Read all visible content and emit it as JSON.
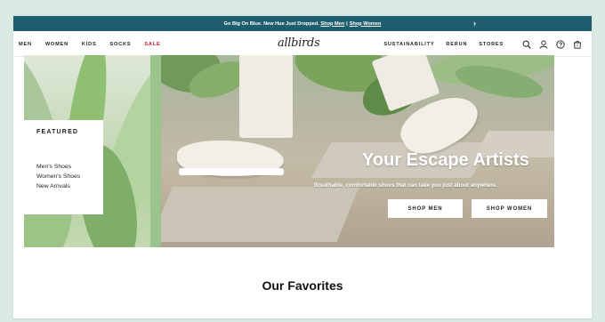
{
  "promo": {
    "text": "Go Big On Blue. New Hue Just Dropped.",
    "link_men": "Shop Men",
    "separator": "|",
    "link_women": "Shop Women",
    "arrow_icon": "chevron-right-icon",
    "bg_color": "#1f5e6e"
  },
  "nav": {
    "left": [
      "MEN",
      "WOMEN",
      "KIDS",
      "SOCKS",
      "SALE"
    ],
    "logo": "allbirds",
    "right": [
      "SUSTAINABILITY",
      "RERUN",
      "STORES"
    ],
    "icons": [
      "search-icon",
      "account-icon",
      "help-icon",
      "cart-icon"
    ],
    "cart_count": "0",
    "sale_color": "#c8102e"
  },
  "featured": {
    "title": "FEATURED",
    "links": [
      "Men's Shoes",
      "Women's Shoes",
      "New Arrivals"
    ]
  },
  "hero": {
    "title": "Your Escape Artists",
    "subtitle": "Breathable, comfortable shoes that can take you just about anywhere.",
    "button_men": "SHOP MEN",
    "button_women": "SHOP WOMEN"
  },
  "section": {
    "title": "Our Favorites"
  }
}
